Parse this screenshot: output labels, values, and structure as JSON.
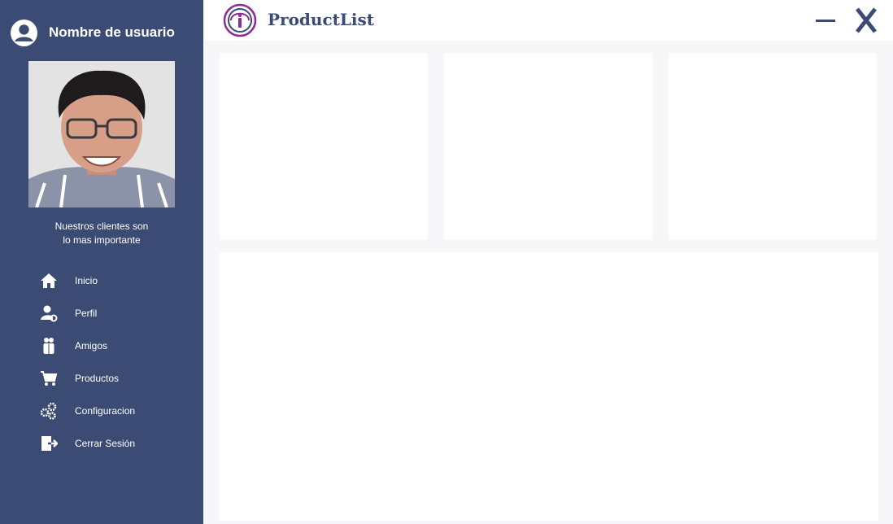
{
  "sidebar": {
    "user_name": "Nombre de usuario",
    "tagline_line1": "Nuestros clientes son",
    "tagline_line2": "lo mas importante",
    "menu": [
      {
        "label": "Inicio",
        "icon": "home-icon"
      },
      {
        "label": "Perfil",
        "icon": "profile-settings-icon"
      },
      {
        "label": "Amigos",
        "icon": "friends-icon"
      },
      {
        "label": "Productos",
        "icon": "cart-icon"
      },
      {
        "label": "Configuracion",
        "icon": "gears-icon"
      },
      {
        "label": "Cerrar Sesión",
        "icon": "logout-icon"
      }
    ]
  },
  "header": {
    "title": "ProductList",
    "logo_icon": "productlist-logo",
    "minimize_icon": "minimize-icon",
    "close_icon": "close-icon"
  },
  "colors": {
    "sidebar_bg": "#3b4b73",
    "page_bg": "#f7f6f9",
    "card_bg": "#ffffff",
    "logo_accent": "#8e2a96"
  }
}
